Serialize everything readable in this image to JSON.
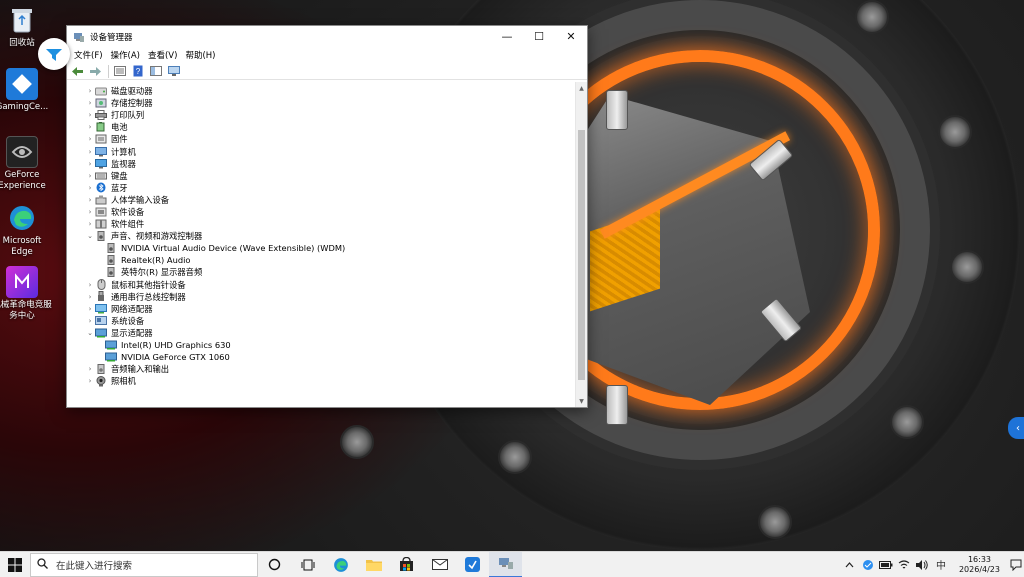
{
  "desktop": {
    "icons": [
      {
        "id": "recycle",
        "label": "回收站"
      },
      {
        "id": "gamingcenter",
        "label": "GamingCe..."
      },
      {
        "id": "geforce",
        "label": "GeForce Experience"
      },
      {
        "id": "edge",
        "label": "Microsoft Edge"
      },
      {
        "id": "mechrev",
        "label": "机械革命电竞服务中心"
      }
    ]
  },
  "window": {
    "title": "设备管理器",
    "controls": {
      "minimize": "—",
      "maximize": "☐",
      "close": "✕"
    },
    "menu": [
      "文件(F)",
      "操作(A)",
      "查看(V)",
      "帮助(H)"
    ],
    "tree": [
      {
        "label": "磁盘驱动器",
        "icon": "disk-icon",
        "expanded": false,
        "child": false
      },
      {
        "label": "存储控制器",
        "icon": "storage-icon",
        "expanded": false,
        "child": false
      },
      {
        "label": "打印队列",
        "icon": "printer-icon",
        "expanded": false,
        "child": false
      },
      {
        "label": "电池",
        "icon": "battery-icon",
        "expanded": false,
        "child": false
      },
      {
        "label": "固件",
        "icon": "firmware-icon",
        "expanded": false,
        "child": false
      },
      {
        "label": "计算机",
        "icon": "computer-icon",
        "expanded": false,
        "child": false
      },
      {
        "label": "监视器",
        "icon": "monitor-icon",
        "expanded": false,
        "child": false
      },
      {
        "label": "键盘",
        "icon": "keyboard-icon",
        "expanded": false,
        "child": false
      },
      {
        "label": "蓝牙",
        "icon": "bluetooth-icon",
        "expanded": false,
        "child": false
      },
      {
        "label": "人体学输入设备",
        "icon": "hid-icon",
        "expanded": false,
        "child": false
      },
      {
        "label": "软件设备",
        "icon": "software-device-icon",
        "expanded": false,
        "child": false
      },
      {
        "label": "软件组件",
        "icon": "software-component-icon",
        "expanded": false,
        "child": false
      },
      {
        "label": "声音、视频和游戏控制器",
        "icon": "speaker-icon",
        "expanded": true,
        "child": false
      },
      {
        "label": "NVIDIA Virtual Audio Device (Wave Extensible) (WDM)",
        "icon": "speaker-icon",
        "expanded": null,
        "child": true
      },
      {
        "label": "Realtek(R) Audio",
        "icon": "speaker-icon",
        "expanded": null,
        "child": true
      },
      {
        "label": "英特尔(R) 显示器音频",
        "icon": "speaker-icon",
        "expanded": null,
        "child": true
      },
      {
        "label": "鼠标和其他指针设备",
        "icon": "mouse-icon",
        "expanded": false,
        "child": false
      },
      {
        "label": "通用串行总线控制器",
        "icon": "usb-icon",
        "expanded": false,
        "child": false
      },
      {
        "label": "网络适配器",
        "icon": "network-icon",
        "expanded": false,
        "child": false
      },
      {
        "label": "系统设备",
        "icon": "system-device-icon",
        "expanded": false,
        "child": false
      },
      {
        "label": "显示适配器",
        "icon": "display-adapter-icon",
        "expanded": true,
        "child": false
      },
      {
        "label": "Intel(R) UHD Graphics 630",
        "icon": "display-adapter-icon",
        "expanded": null,
        "child": true
      },
      {
        "label": "NVIDIA GeForce GTX 1060",
        "icon": "display-adapter-icon",
        "expanded": null,
        "child": true
      },
      {
        "label": "音频输入和输出",
        "icon": "audio-io-icon",
        "expanded": false,
        "child": false
      },
      {
        "label": "照相机",
        "icon": "camera-icon",
        "expanded": false,
        "child": false
      }
    ]
  },
  "taskbar": {
    "search_placeholder": "在此键入进行搜索",
    "ime": "中",
    "time": "16:33",
    "date": "2026/4/23"
  }
}
